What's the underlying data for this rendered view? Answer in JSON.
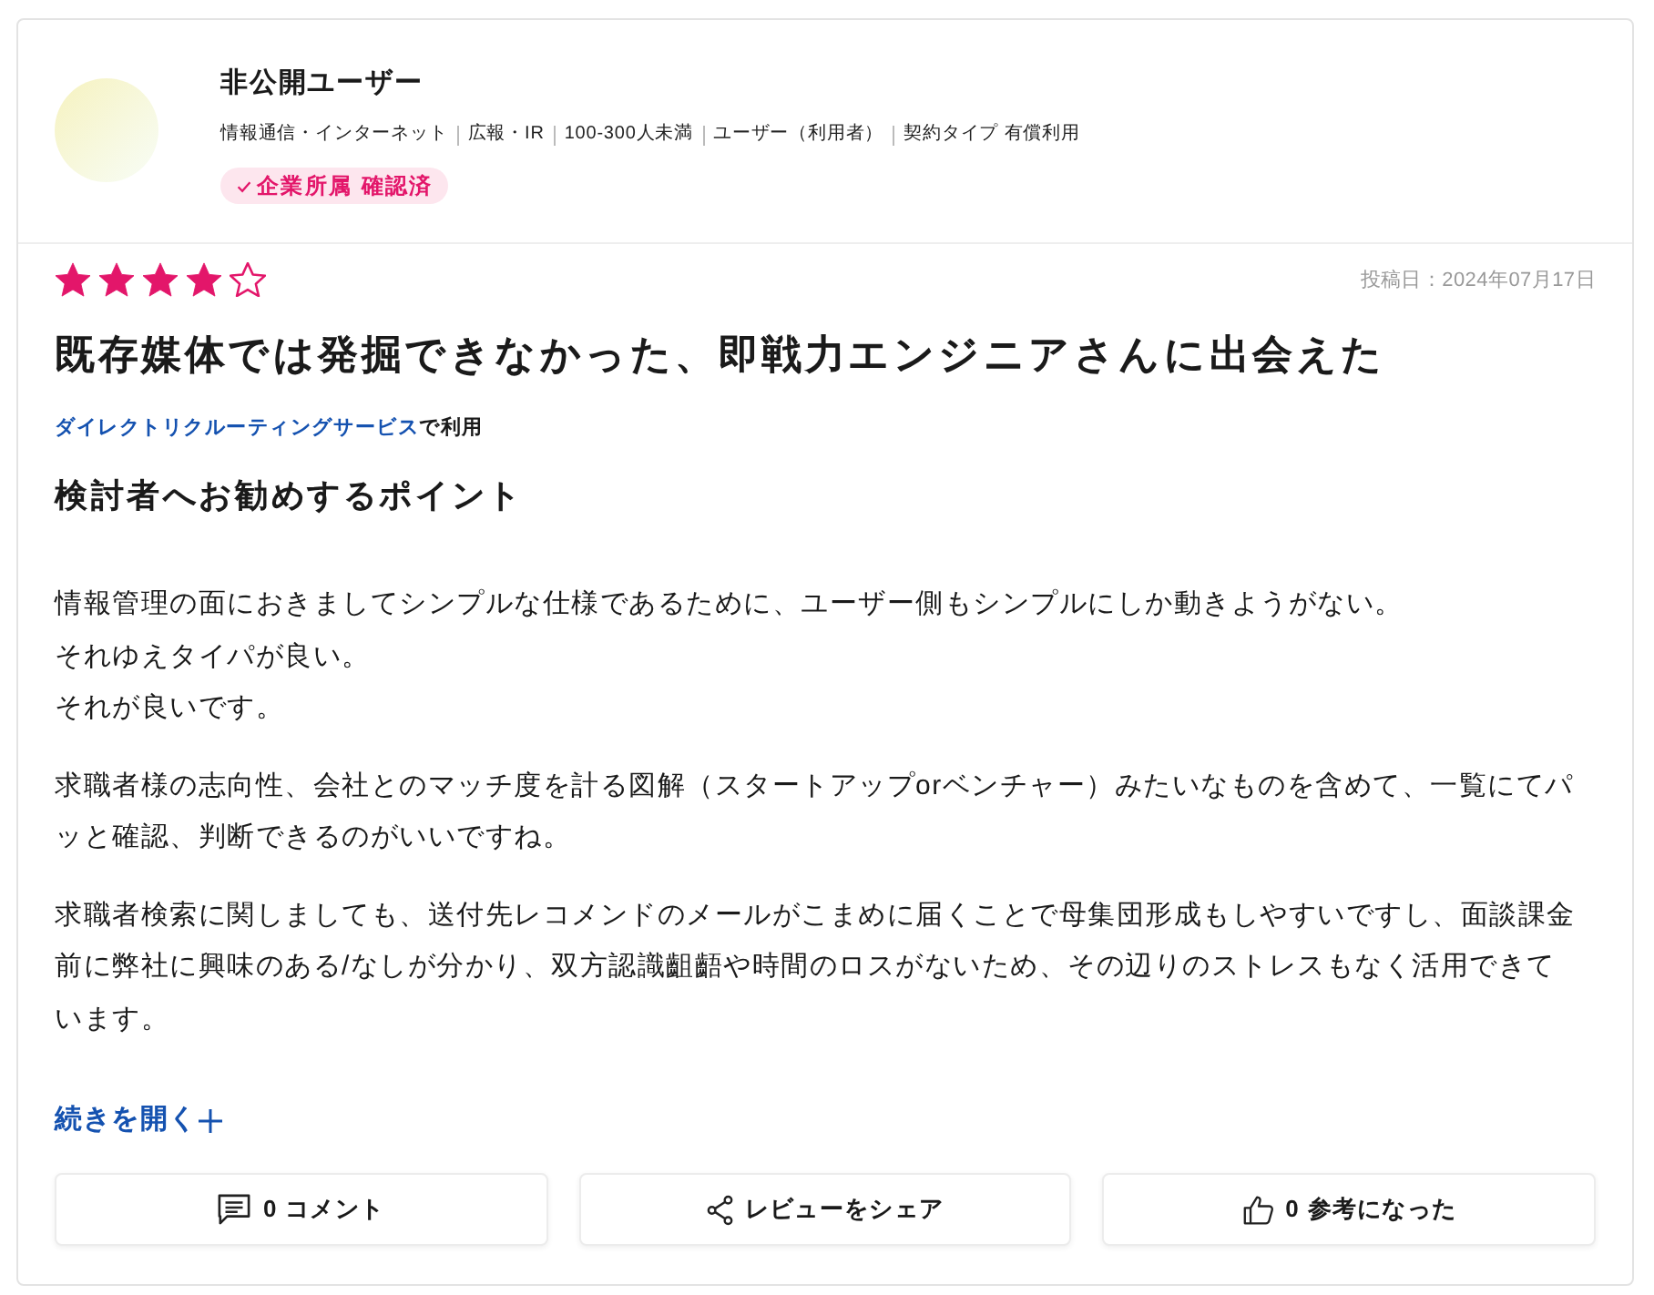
{
  "reviewer": {
    "name": "非公開ユーザー",
    "meta": [
      "情報通信・インターネット",
      "広報・IR",
      "100-300人未満",
      "ユーザー（利用者）",
      "契約タイプ 有償利用"
    ],
    "badge": {
      "label": "企業所属 確認済"
    }
  },
  "review": {
    "stars": 4,
    "date": "投稿日：2024年07月17日",
    "title": "既存媒体では発掘できなかった、即戦力エンジニアさんに出会えた",
    "service": {
      "link": "ダイレクトリクルーティングサービス",
      "suffix": "で利用"
    },
    "section_heading": "検討者へお勧めするポイント",
    "paragraphs": [
      {
        "lines": [
          "情報管理の面におきましてシンプルな仕様であるために、ユーザー側もシンプルにしか動きようがない。",
          "それゆえタイパが良い。",
          "それが良いです。"
        ]
      },
      {
        "lines": [
          "求職者様の志向性、会社とのマッチ度を計る図解（スタートアップorベンチャー）みたいなものを含めて、一覧にてパ",
          "ッと確認、判断できるのがいいですね。"
        ]
      },
      {
        "lines": [
          "求職者検索に関しましても、送付先レコメンドのメールがこまめに届くことで母集団形成もしやすいですし、面談課金",
          "前に弊社に興味のある/なしが分かり、双方認識齟齬や時間のロスがないため、その辺りのストレスもなく活用できて",
          "います。"
        ]
      }
    ],
    "read_more": "続きを開く"
  },
  "actions": [
    {
      "kind": "comment",
      "label": "0 コメント"
    },
    {
      "kind": "share",
      "label": "レビューをシェア"
    },
    {
      "kind": "like",
      "label": "0 参考になった"
    }
  ]
}
